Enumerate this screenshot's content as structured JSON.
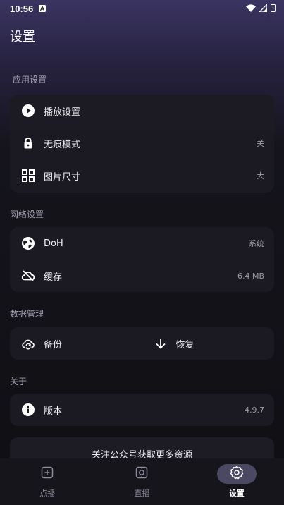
{
  "status_bar": {
    "time": "10:56",
    "notification_icon": "a-badge-icon",
    "icons": [
      "wifi-icon",
      "cellular-icon",
      "battery-icon"
    ]
  },
  "page": {
    "title": "设置"
  },
  "sections": {
    "app_settings": {
      "label": "应用设置",
      "items": [
        {
          "icon": "play-circle-icon",
          "label": "播放设置",
          "value": ""
        },
        {
          "icon": "lock-icon",
          "label": "无痕模式",
          "value": "关"
        },
        {
          "icon": "grid-icon",
          "label": "图片尺寸",
          "value": "大"
        }
      ]
    },
    "network_settings": {
      "label": "网络设置",
      "items": [
        {
          "icon": "globe-icon",
          "label": "DoH",
          "value": "系统"
        },
        {
          "icon": "cloud-off-icon",
          "label": "缓存",
          "value": "6.4 MB"
        }
      ]
    },
    "data_management": {
      "label": "数据管理",
      "backup": {
        "icon": "cloud-sync-icon",
        "label": "备份"
      },
      "restore": {
        "icon": "arrow-down-icon",
        "label": "恢复"
      }
    },
    "about": {
      "label": "关于",
      "items": [
        {
          "icon": "info-icon",
          "label": "版本",
          "value": "4.9.7"
        }
      ]
    }
  },
  "promo": {
    "text": "关注公众号获取更多资源"
  },
  "bottom_nav": [
    {
      "icon": "plus-square-icon",
      "label": "点播",
      "active": false
    },
    {
      "icon": "live-tv-icon",
      "label": "直播",
      "active": false
    },
    {
      "icon": "settings-gear-icon",
      "label": "设置",
      "active": true
    }
  ],
  "colors": {
    "accent_pill": "#4b4863",
    "card_bg": "#1c1b24",
    "header_gradient_top": "#3a3461"
  }
}
